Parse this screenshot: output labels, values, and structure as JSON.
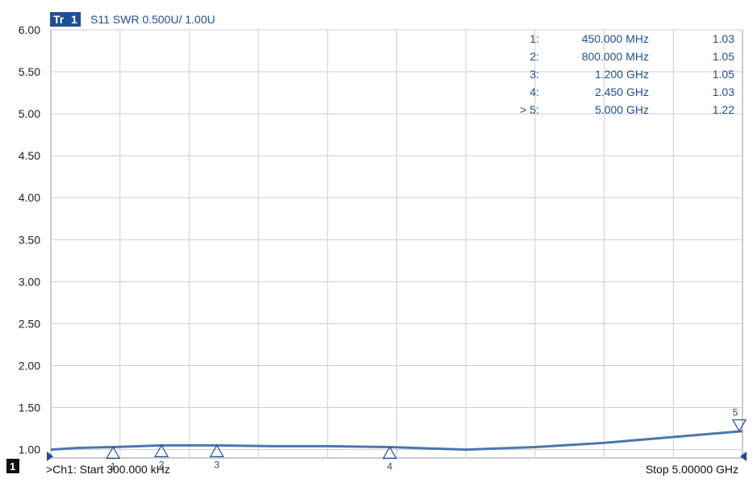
{
  "trace": {
    "badge_tr": "Tr",
    "badge_num": "1",
    "title": "S11 SWR 0.500U/  1.00U"
  },
  "channel": {
    "badge": "1",
    "start_label": ">Ch1: Start  300.000 kHz",
    "stop_label": "Stop  5.00000 GHz"
  },
  "markers": [
    {
      "id": "1:",
      "freq": "450.000 MHz",
      "value": "1.03",
      "x_ghz": 0.45,
      "swr": 1.03,
      "label": "1"
    },
    {
      "id": "2:",
      "freq": "800.000 MHz",
      "value": "1.05",
      "x_ghz": 0.8,
      "swr": 1.05,
      "label": "2"
    },
    {
      "id": "3:",
      "freq": "1.200 GHz",
      "value": "1.05",
      "x_ghz": 1.2,
      "swr": 1.05,
      "label": "3"
    },
    {
      "id": "4:",
      "freq": "2.450 GHz",
      "value": "1.03",
      "x_ghz": 2.45,
      "swr": 1.03,
      "label": "4"
    },
    {
      "id": "> 5:",
      "freq": "5.000 GHz",
      "value": "1.22",
      "x_ghz": 5.0,
      "swr": 1.22,
      "label": "5"
    }
  ],
  "colors": {
    "trace": "#4a78ac",
    "marker": "#1f4e96",
    "grid": "#cfcfcf",
    "badge_bg": "#1f4e96"
  },
  "chart_data": {
    "type": "line",
    "title": "S11 SWR 0.500U/  1.00U",
    "xlabel": "",
    "ylabel": "",
    "xlim": [
      0.0003,
      5.0
    ],
    "ylim": [
      0.9,
      6.0
    ],
    "yticks": [
      "6.00",
      "5.50",
      "5.00",
      "4.50",
      "4.00",
      "3.50",
      "3.00",
      "2.50",
      "2.00",
      "1.50",
      "1.00"
    ],
    "ytick_values": [
      6.0,
      5.5,
      5.0,
      4.5,
      4.0,
      3.5,
      3.0,
      2.5,
      2.0,
      1.5,
      1.0
    ],
    "x_divisions": 10,
    "grid": true,
    "series": [
      {
        "x": [
          0.0003,
          0.2,
          0.45,
          0.8,
          1.2,
          1.6,
          2.0,
          2.45,
          3.0,
          3.5,
          4.0,
          4.5,
          5.0
        ],
        "y": [
          1.0,
          1.02,
          1.03,
          1.05,
          1.05,
          1.04,
          1.04,
          1.03,
          1.0,
          1.03,
          1.08,
          1.15,
          1.22
        ]
      }
    ]
  }
}
